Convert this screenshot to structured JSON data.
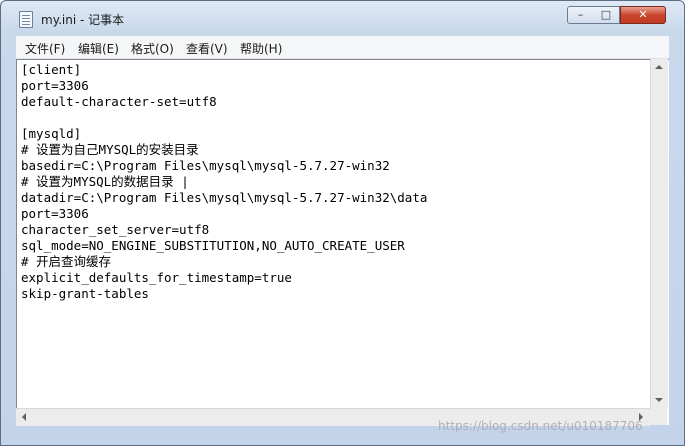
{
  "window": {
    "title": "my.ini - 记事本",
    "controls": {
      "minimize": "–",
      "maximize": "□",
      "close": "✕"
    }
  },
  "menu": [
    "文件(F)",
    "编辑(E)",
    "格式(O)",
    "查看(V)",
    "帮助(H)"
  ],
  "editor": {
    "lines": [
      "[client]",
      "port=3306",
      "default-character-set=utf8",
      "",
      "[mysqld]",
      "# 设置为自己MYSQL的安装目录",
      "basedir=C:\\Program Files\\mysql\\mysql-5.7.27-win32",
      "# 设置为MYSQL的数据目录 |",
      "datadir=C:\\Program Files\\mysql\\mysql-5.7.27-win32\\data",
      "port=3306",
      "character_set_server=utf8",
      "sql_mode=NO_ENGINE_SUBSTITUTION,NO_AUTO_CREATE_USER",
      "# 开启查询缓存",
      "explicit_defaults_for_timestamp=true",
      "skip-grant-tables"
    ]
  },
  "watermark": "https://blog.csdn.net/u010187706"
}
